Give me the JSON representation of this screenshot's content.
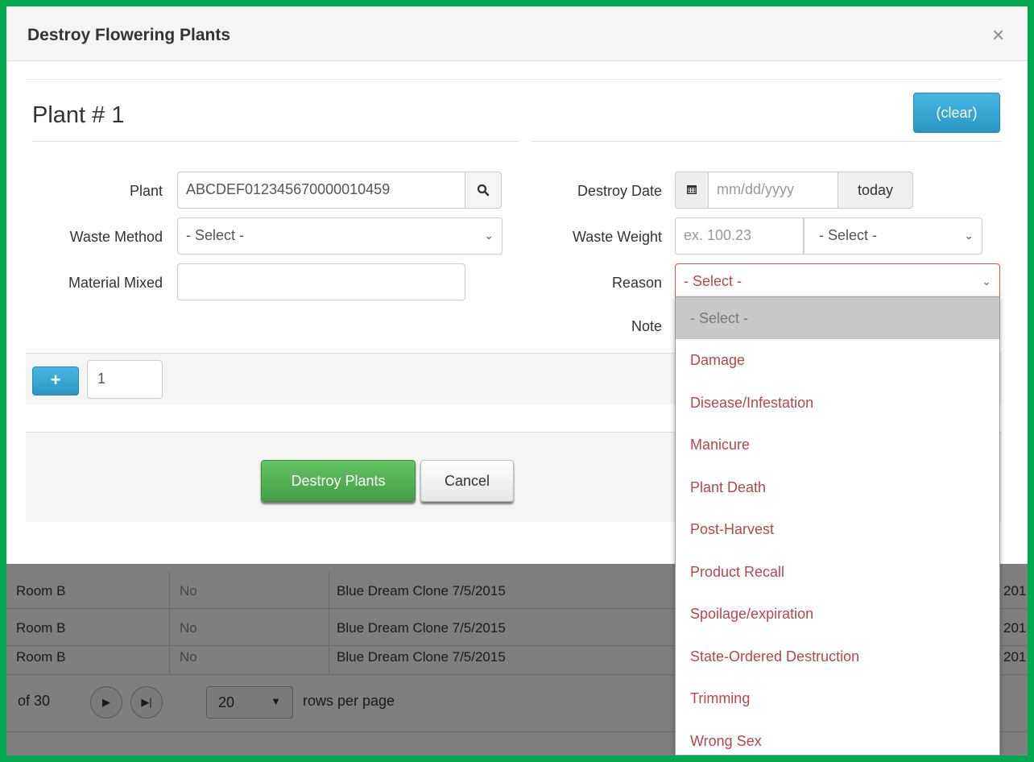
{
  "modal": {
    "title": "Destroy Flowering Plants",
    "close_glyph": "×"
  },
  "plant": {
    "heading": "Plant # 1",
    "clear_label": "(clear)"
  },
  "form": {
    "plant_label": "Plant",
    "plant_value": "ABCDEF012345670000010459",
    "waste_method_label": "Waste Method",
    "waste_method_value": "- Select -",
    "material_mixed_label": "Material Mixed",
    "material_mixed_value": "",
    "destroy_date_label": "Destroy Date",
    "destroy_date_placeholder": "mm/dd/yyyy",
    "today_label": "today",
    "waste_weight_label": "Waste Weight",
    "waste_weight_placeholder": "ex. 100.23",
    "waste_weight_unit_value": "- Select -",
    "reason_label": "Reason",
    "reason_value": "- Select -",
    "note_label": "Note"
  },
  "add_row": {
    "plus_glyph": "+",
    "count_value": "1"
  },
  "footer": {
    "destroy_label": "Destroy Plants",
    "cancel_label": "Cancel"
  },
  "reason_options": [
    "- Select -",
    "Damage",
    "Disease/Infestation",
    "Manicure",
    "Plant Death",
    "Post-Harvest",
    "Product Recall",
    "Spoilage/expiration",
    "State-Ordered Destruction",
    "Trimming",
    "Wrong Sex"
  ],
  "background_table": {
    "rows": [
      {
        "room": "Room B",
        "flag": "No",
        "strain": "Blue Dream Clone 7/5/2015",
        "date_fragment": "201"
      },
      {
        "room": "Room B",
        "flag": "No",
        "strain": "Blue Dream Clone 7/5/2015",
        "date_fragment": "201"
      },
      {
        "room": "Room B",
        "flag": "No",
        "strain": "Blue Dream Clone 7/5/2015",
        "date_fragment": "201"
      }
    ],
    "pager": {
      "of_text": "of 30",
      "rows_value": "20",
      "rows_per_page_label": "rows per page"
    }
  },
  "colors": {
    "frame_green": "#00a84f",
    "primary_blue": "#31a7d6",
    "success_green": "#5cb85c",
    "error_red": "#d9534f",
    "option_text": "#b5474b"
  },
  "icons": {
    "search": "search-icon",
    "calendar": "calendar-icon",
    "chevron": "chevron-down-icon",
    "next": "next-page-icon",
    "last": "last-page-icon"
  }
}
